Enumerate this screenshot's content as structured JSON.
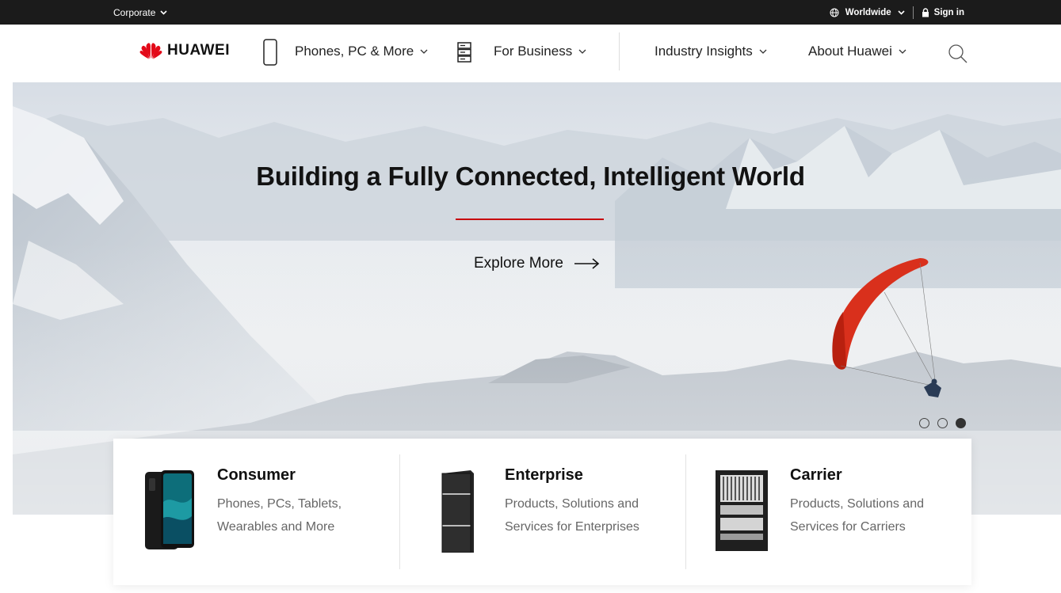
{
  "topbar": {
    "corporate": "Corporate",
    "worldwide": "Worldwide",
    "signin": "Sign in"
  },
  "brand": {
    "name": "HUAWEI",
    "logo_color": "#e30a19"
  },
  "nav": {
    "items": [
      {
        "label": "Phones, PC & More",
        "icon": "phone-icon"
      },
      {
        "label": "For Business",
        "icon": "server-icon"
      },
      {
        "label": "Industry Insights"
      },
      {
        "label": "About Huawei"
      }
    ],
    "search_icon": "search-icon"
  },
  "hero": {
    "title": "Building a Fully Connected, Intelligent World",
    "accent": "#c7000b",
    "cta": "Explore More",
    "carousel": {
      "slides": 3,
      "active_index": 2
    }
  },
  "cards": [
    {
      "title": "Consumer",
      "description": "Phones, PCs, Tablets, Wearables and More",
      "icon": "smartphone-image"
    },
    {
      "title": "Enterprise",
      "description": "Products, Solutions and Services for Enterprises",
      "icon": "server-rack-image"
    },
    {
      "title": "Carrier",
      "description": "Products, Solutions and Services for Carriers",
      "icon": "network-cabinet-image"
    }
  ]
}
